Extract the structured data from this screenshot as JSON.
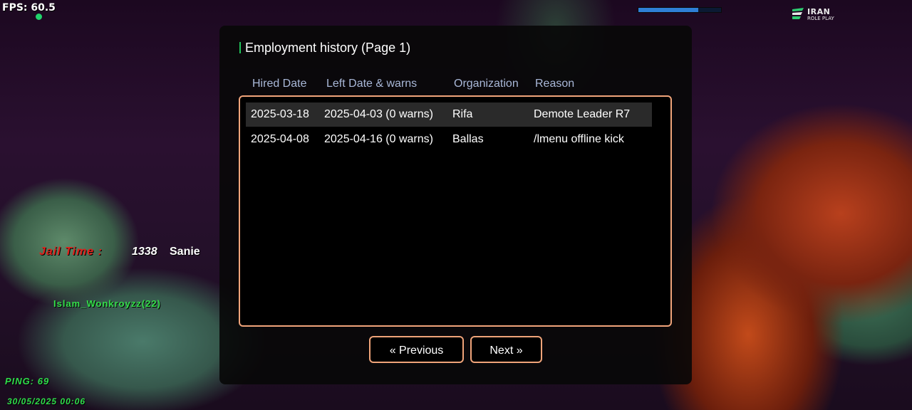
{
  "hud": {
    "fps": "FPS: 60.5",
    "hp_fraction": 0.72,
    "logo_line1": "IRAN",
    "logo_line2": "ROLE PLAY",
    "jail_label": "Jail Time :",
    "jail_time": "1338",
    "jail_name": "Sanie",
    "player_tag": "Islam_Wonkroyzz(22)",
    "ping": "PING: 69",
    "datetime": "30/05/2025 00:06"
  },
  "dialog": {
    "title": "Employment history (Page 1)",
    "columns": [
      "Hired Date",
      "Left Date & warns",
      "Organization",
      "Reason"
    ],
    "rows": [
      [
        "2025-03-18",
        "2025-04-03 (0 warns)",
        "Rifa",
        "Demote Leader R7"
      ],
      [
        "2025-04-08",
        "2025-04-16 (0 warns)",
        "Ballas",
        "/lmenu offline kick"
      ]
    ],
    "prev_label": "« Previous",
    "next_label": "Next »"
  },
  "colors": {
    "accent_border": "#f0a47a",
    "header_text": "#a9b8d8",
    "hud_green": "#2fdc4a",
    "jail_red": "#e0221c"
  }
}
